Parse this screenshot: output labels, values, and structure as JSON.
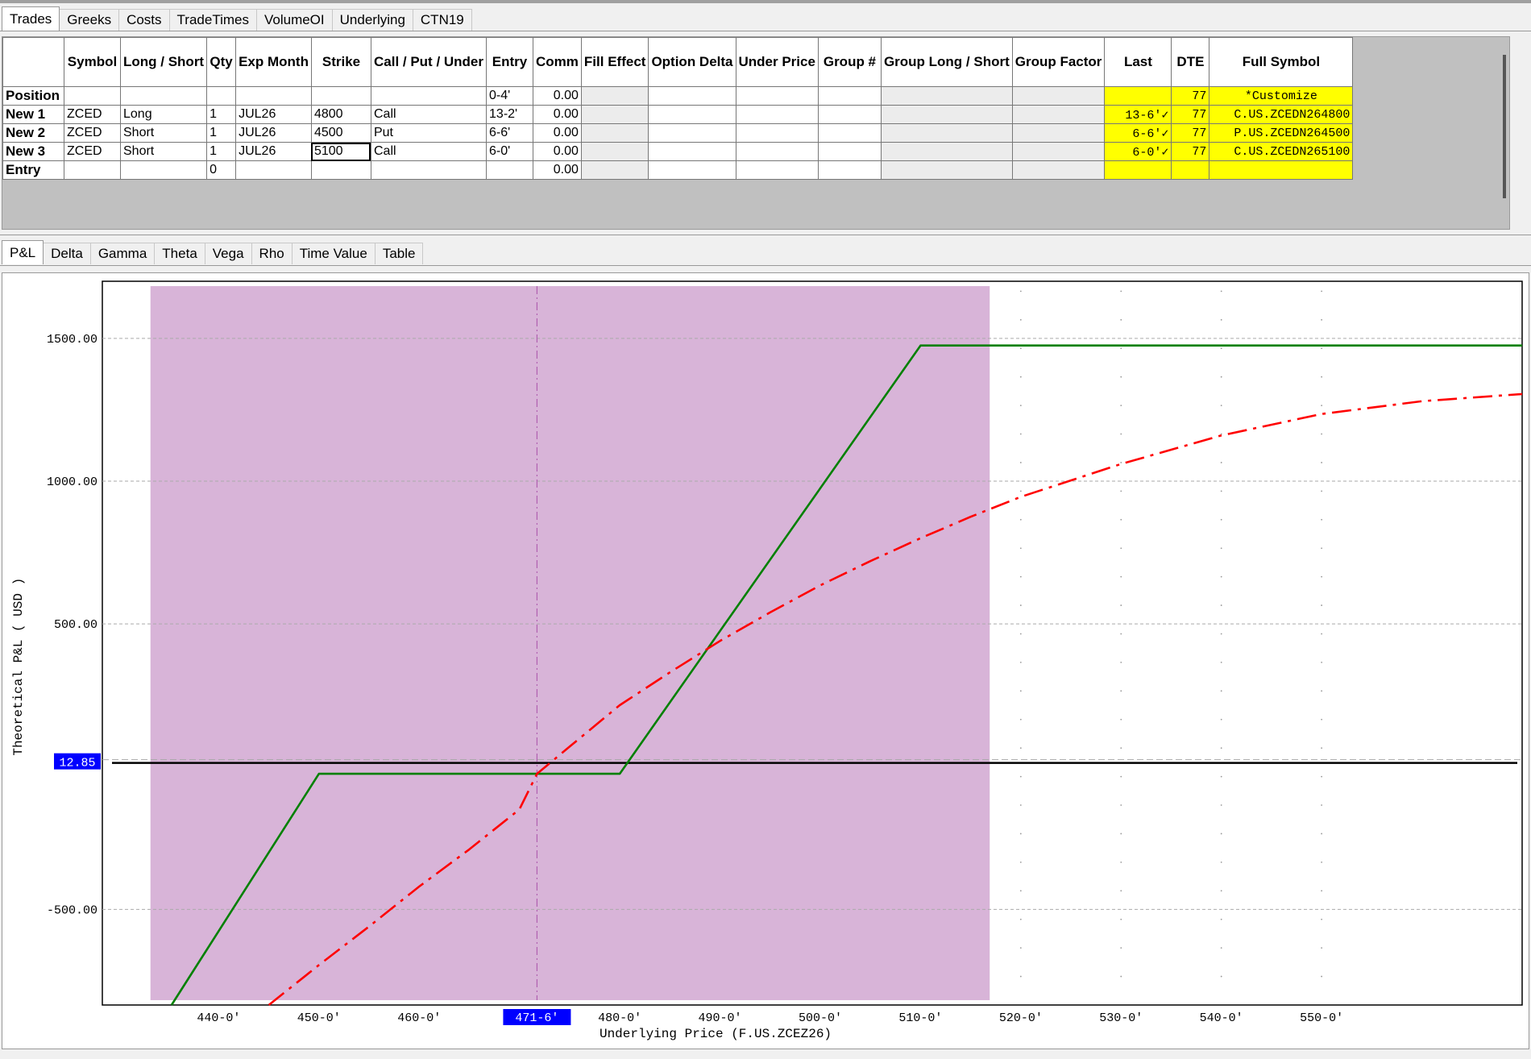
{
  "top_tabs": [
    "Trades",
    "Greeks",
    "Costs",
    "TradeTimes",
    "VolumeOI",
    "Underlying",
    "CTN19"
  ],
  "table": {
    "headers": [
      "",
      "Symbol",
      "Long / Short",
      "Qty",
      "Exp Month",
      "Strike",
      "Call / Put / Under",
      "Entry",
      "Comm",
      "Fill Effect",
      "Option Delta",
      "Under Price",
      "Group #",
      "Group Long / Short",
      "Group Factor",
      "Last",
      "DTE",
      "Full Symbol"
    ],
    "rows": [
      {
        "label": "Position",
        "symbol": "",
        "ls": "",
        "qty": "",
        "exp": "",
        "strike": "",
        "cpu": "",
        "entry": "0-4'",
        "comm": "0.00",
        "last": "",
        "dte": "77",
        "full": "*Customize"
      },
      {
        "label": "New 1",
        "symbol": "ZCED",
        "ls": "Long",
        "qty": "1",
        "exp": "JUL26",
        "strike": "4800",
        "cpu": "Call",
        "entry": "13-2'",
        "comm": "0.00",
        "last": "13-6'✓",
        "dte": "77",
        "full": "C.US.ZCEDN264800"
      },
      {
        "label": "New 2",
        "symbol": "ZCED",
        "ls": "Short",
        "qty": "1",
        "exp": "JUL26",
        "strike": "4500",
        "cpu": "Put",
        "entry": "6-6'",
        "comm": "0.00",
        "last": "6-6'✓",
        "dte": "77",
        "full": "P.US.ZCEDN264500"
      },
      {
        "label": "New 3",
        "symbol": "ZCED",
        "ls": "Short",
        "qty": "1",
        "exp": "JUL26",
        "strike": "5100",
        "cpu": "Call",
        "entry": "6-0'",
        "comm": "0.00",
        "last": "6-0'✓",
        "dte": "77",
        "full": "C.US.ZCEDN265100"
      },
      {
        "label": "Entry",
        "symbol": "",
        "ls": "",
        "qty": "0",
        "exp": "",
        "strike": "",
        "cpu": "",
        "entry": "",
        "comm": "0.00",
        "last": "",
        "dte": "",
        "full": ""
      }
    ]
  },
  "chart_tabs": [
    "P&L",
    "Delta",
    "Gamma",
    "Theta",
    "Vega",
    "Rho",
    "Time Value",
    "Table"
  ],
  "chart_data": {
    "type": "line",
    "xlabel": "Underlying Price (F.US.ZCEZ26)",
    "ylabel": "Theoretical P&L ( USD )",
    "xlim": [
      428.4,
      570
    ],
    "ylim": [
      -835,
      1700
    ],
    "x_ticks": [
      440,
      450,
      460,
      470,
      480,
      490,
      500,
      510,
      520,
      530,
      540,
      550
    ],
    "x_tick_labels": [
      "440-0'",
      "450-0'",
      "460-0'",
      "4",
      "480-0'",
      "490-0'",
      "500-0'",
      "510-0'",
      "520-0'",
      "530-0'",
      "540-0'",
      "550-0'"
    ],
    "y_ticks": [
      1500,
      1000,
      500,
      -500
    ],
    "y_tick_labels": [
      "1500.00",
      "1000.00",
      "500.00",
      "-500.00"
    ],
    "current_price_label": "471-6'",
    "current_price": 471.75,
    "shaded_range": [
      433.2,
      516.9
    ],
    "zero_line": 12.85,
    "zero_line_label": "12.85",
    "series": [
      {
        "color": "#008000",
        "style": "solid",
        "x": [
          435.3,
          450,
          480,
          510,
          570
        ],
        "y": [
          -835,
          -25,
          -25,
          1475,
          1475
        ]
      },
      {
        "color": "#ff0000",
        "style": "dashdot",
        "x": [
          445,
          450,
          455,
          460,
          465,
          470,
          471.75,
          475,
          480,
          485,
          490,
          495,
          500,
          505,
          510,
          515,
          520,
          530,
          540,
          550,
          560,
          570
        ],
        "y": [
          -835,
          -695,
          -560,
          -420,
          -290,
          -150,
          -25,
          70,
          215,
          330,
          440,
          540,
          635,
          720,
          800,
          875,
          945,
          1060,
          1160,
          1235,
          1280,
          1305
        ]
      }
    ]
  }
}
